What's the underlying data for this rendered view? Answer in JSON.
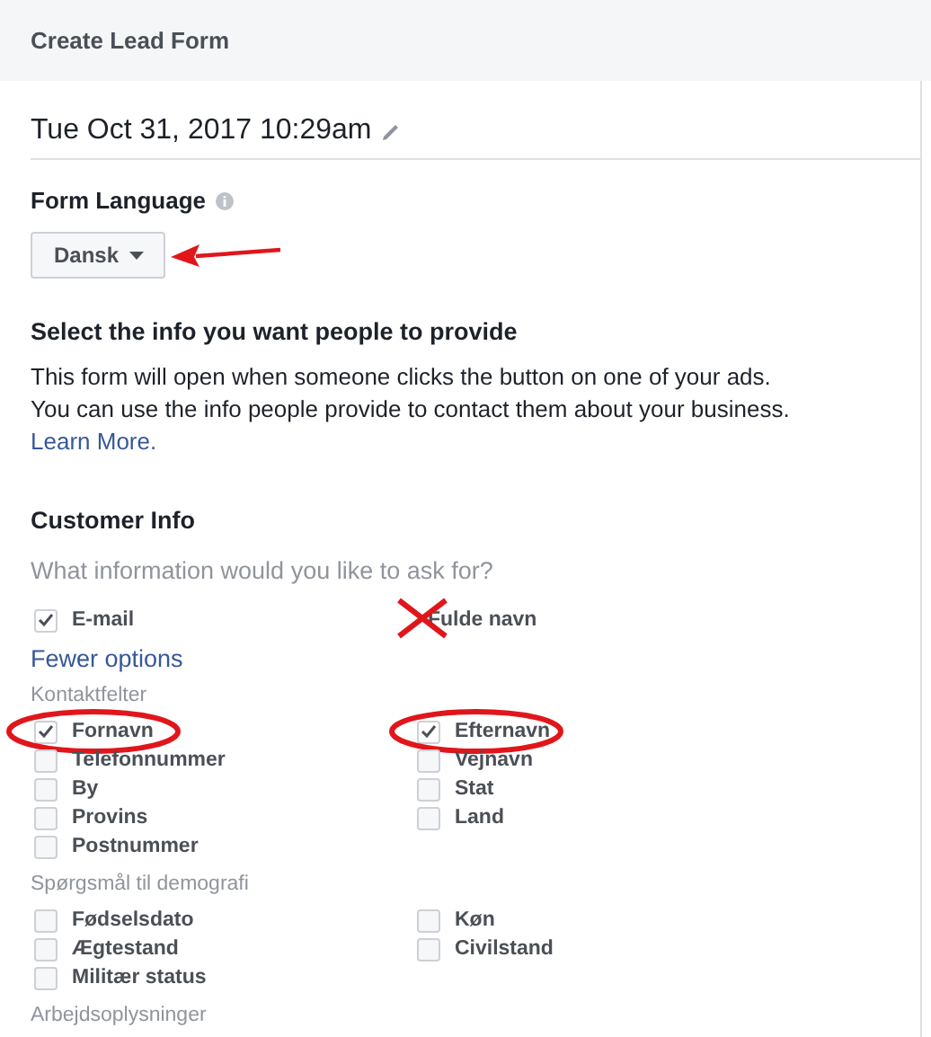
{
  "header": {
    "title": "Create Lead Form"
  },
  "form_name": {
    "value": "Tue Oct 31, 2017 10:29am"
  },
  "language": {
    "label": "Form Language",
    "value": "Dansk",
    "kind": "arrowed"
  },
  "intro": {
    "heading": "Select the info you want people to provide",
    "lines": [
      "This form will open when someone clicks the button on one of your ads.",
      "You can use the info people provide to contact them about your business."
    ],
    "link": "Learn More."
  },
  "customer_info": {
    "heading": "Customer Info",
    "question": "What information would you like to ask for?",
    "top_fields": [
      {
        "label": "E-mail",
        "checked": true,
        "kind": "plain"
      },
      {
        "label": "Fulde navn",
        "kind": "crossed"
      }
    ],
    "toggle_link": "Fewer options",
    "groups": [
      {
        "title": "Kontaktfelter",
        "fields": [
          {
            "label": "Fornavn",
            "checked": true,
            "kind": "circled"
          },
          {
            "label": "Efternavn",
            "checked": true,
            "kind": "circled"
          },
          {
            "label": "Telefonnummer",
            "checked": false
          },
          {
            "label": "Vejnavn",
            "checked": false
          },
          {
            "label": "By",
            "checked": false
          },
          {
            "label": "Stat",
            "checked": false
          },
          {
            "label": "Provins",
            "checked": false
          },
          {
            "label": "Land",
            "checked": false
          },
          {
            "label": "Postnummer",
            "checked": false
          }
        ]
      },
      {
        "title": "Spørgsmål til demografi",
        "fields": [
          {
            "label": "Fødselsdato",
            "checked": false
          },
          {
            "label": "Køn",
            "checked": false
          },
          {
            "label": "Ægtestand",
            "checked": false
          },
          {
            "label": "Civilstand",
            "checked": false
          },
          {
            "label": "Militær status",
            "checked": false
          }
        ]
      },
      {
        "title": "Arbejdsoplysninger"
      }
    ]
  }
}
